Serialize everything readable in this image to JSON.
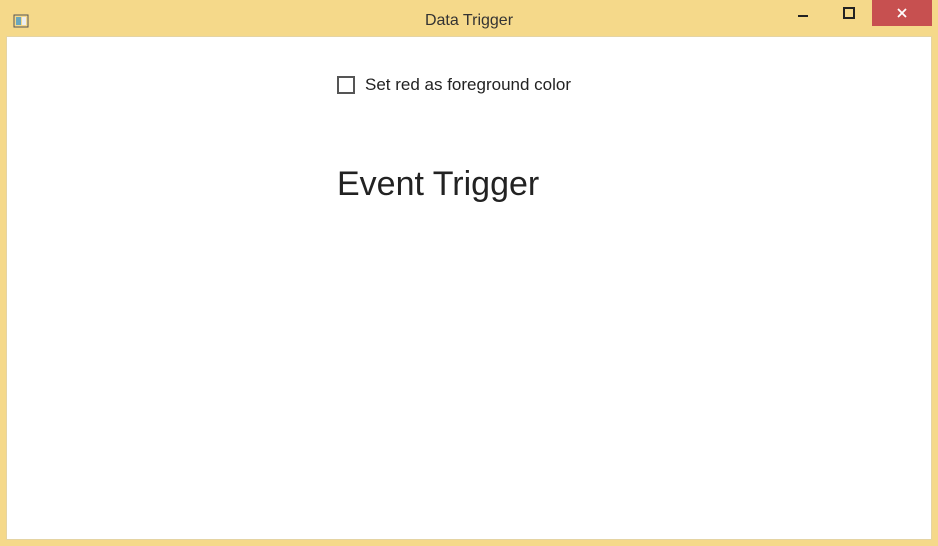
{
  "window": {
    "title": "Data Trigger"
  },
  "content": {
    "checkbox_label": "Set red as foreground color",
    "checkbox_checked": false,
    "heading": "Event Trigger"
  },
  "colors": {
    "chrome": "#f5d98a",
    "close": "#c75050"
  }
}
